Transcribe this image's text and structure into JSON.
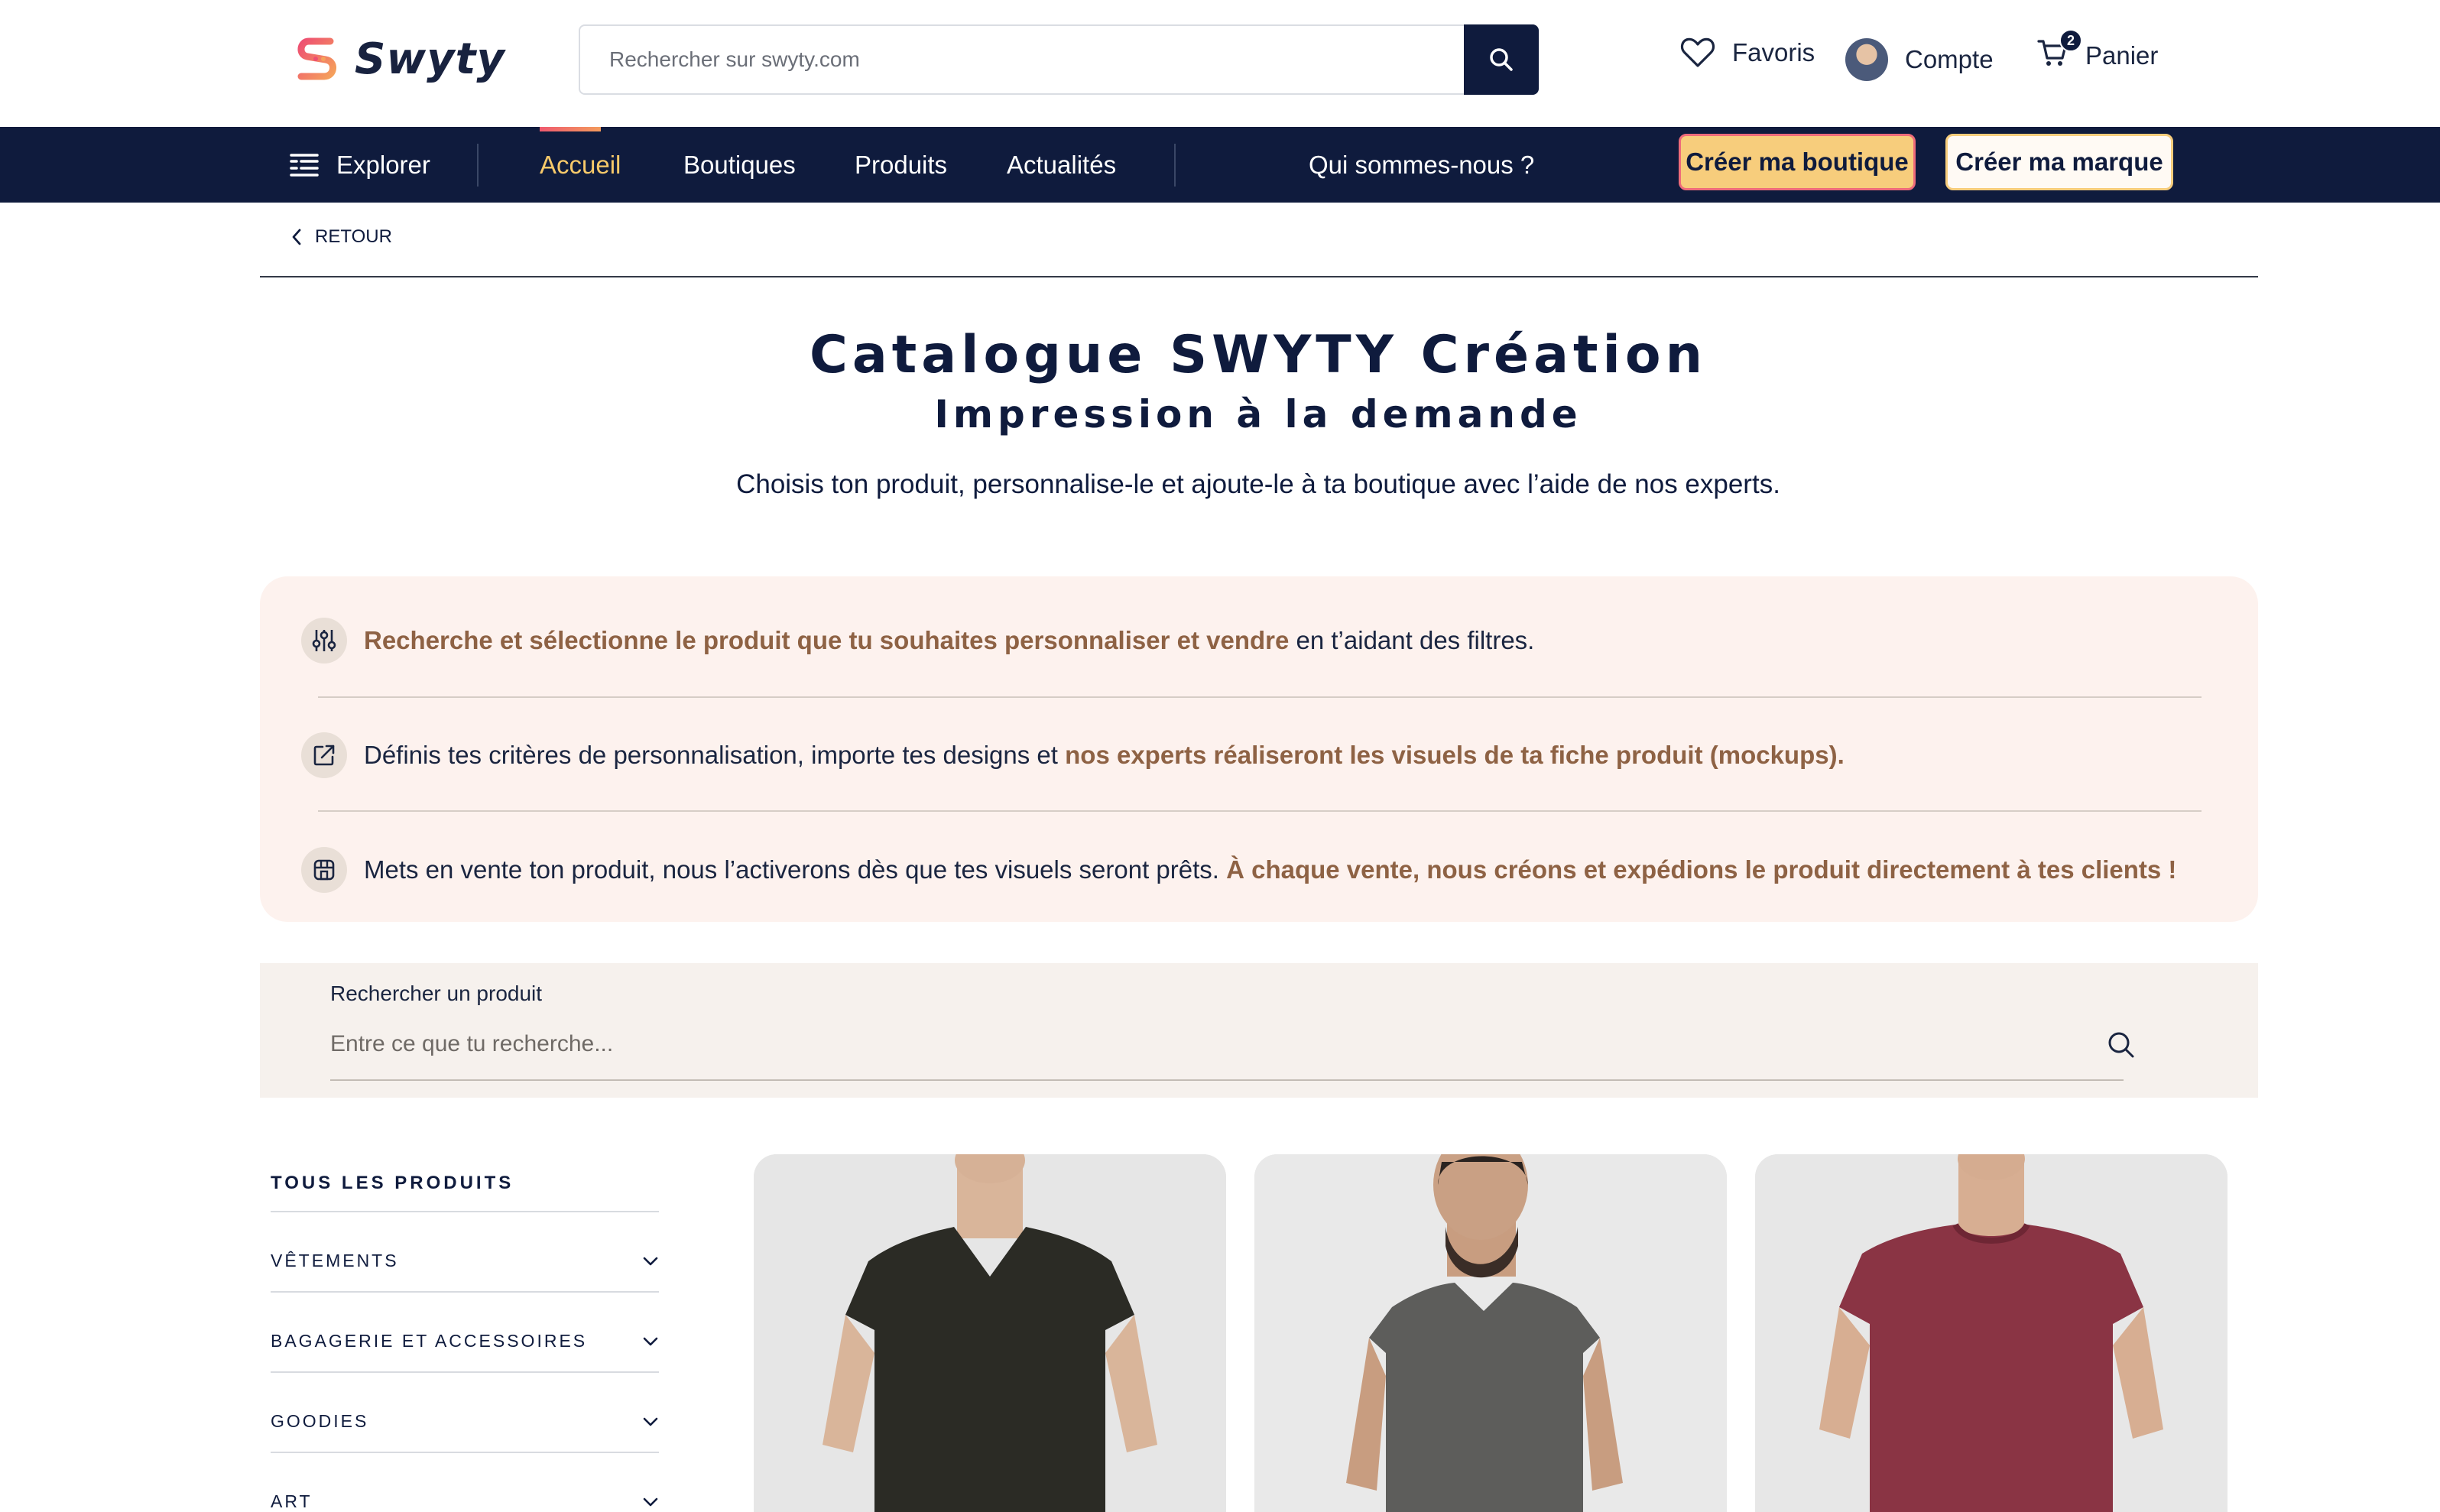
{
  "header": {
    "logo_text": "Swyty",
    "search_placeholder": "Rechercher sur swyty.com",
    "favorites_label": "Favoris",
    "account_label": "Compte",
    "cart_label": "Panier",
    "cart_count": "2"
  },
  "nav": {
    "explore_label": "Explorer",
    "items": [
      {
        "label": "Accueil",
        "active": true
      },
      {
        "label": "Boutiques"
      },
      {
        "label": "Produits"
      },
      {
        "label": "Actualités"
      }
    ],
    "about_label": "Qui sommes-nous ?",
    "cta_shop": "Créer ma boutique",
    "cta_brand": "Créer ma marque"
  },
  "back_label": "RETOUR",
  "hero": {
    "title": "Catalogue SWYTY Création",
    "subtitle": "Impression à la demande",
    "description": "Choisis ton produit, personnalise-le et ajoute-le à ta boutique avec l’aide de nos experts."
  },
  "steps": [
    {
      "icon": "sliders-icon",
      "highlight": "Recherche et sélectionne le produit que tu souhaites personnaliser et vendre",
      "text_after": " en t’aidant des filtres."
    },
    {
      "icon": "edit-external-icon",
      "text_before": "Définis tes critères de personnalisation, importe tes designs et ",
      "highlight": "nos experts réaliseront les visuels de ta fiche produit (mockups)."
    },
    {
      "icon": "storefront-icon",
      "text_before": "Mets en vente ton produit, nous l’activerons dès que tes visuels seront prêts. ",
      "highlight": "À chaque vente, nous créons et expédions le produit directement à tes clients !"
    }
  ],
  "product_search": {
    "label": "Rechercher un produit",
    "placeholder": "Entre ce que tu recherche..."
  },
  "sidebar": {
    "title": "TOUS LES PRODUITS",
    "categories": [
      "VÊTEMENTS",
      "BAGAGERIE ET ACCESSOIRES",
      "GOODIES",
      "ART"
    ]
  },
  "products": [
    {
      "name": "t-shirt-black-vneck",
      "shirt_color": "#2b2b25"
    },
    {
      "name": "t-shirt-grey",
      "shirt_color": "#5d5d5b"
    },
    {
      "name": "t-shirt-burgundy",
      "shirt_color": "#8a3444"
    }
  ],
  "colors": {
    "navy": "#0f1b3d",
    "accent_yellow": "#f7c96a",
    "highlight_brown": "#8e6244",
    "steps_bg": "#fdf2ee"
  }
}
